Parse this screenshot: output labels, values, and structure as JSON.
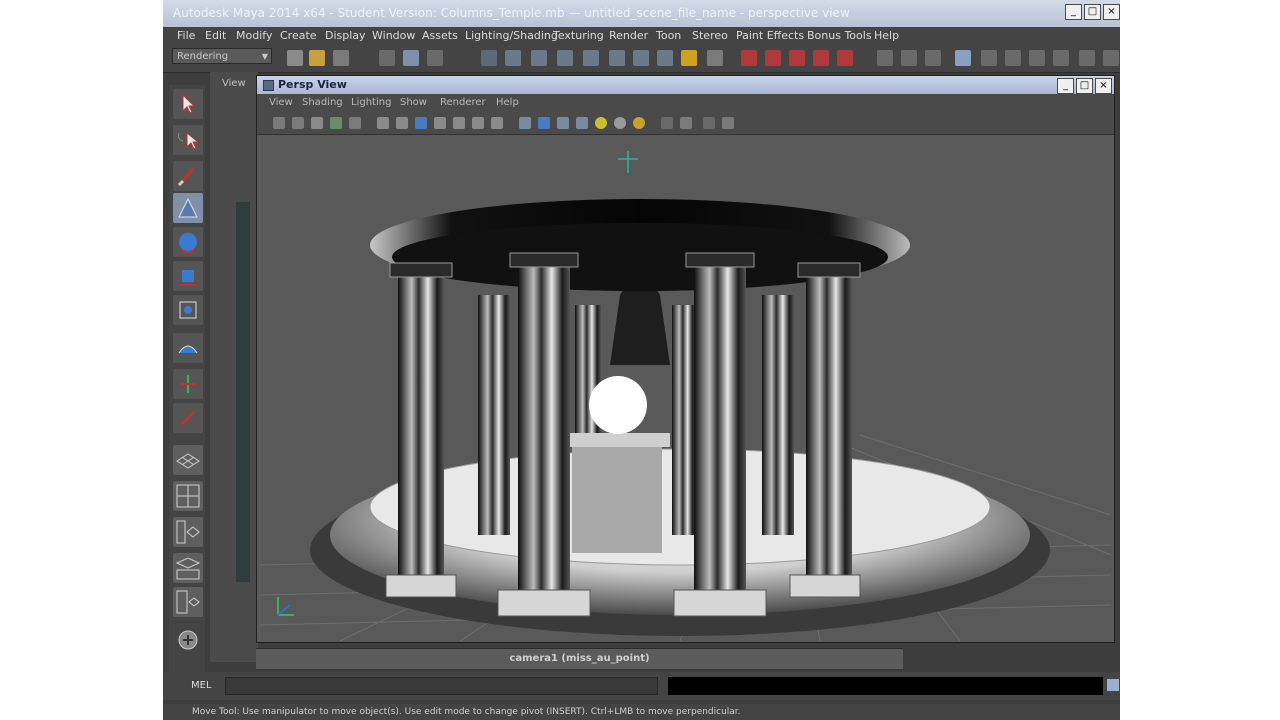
{
  "window": {
    "title": "Autodesk Maya 2014 x64 - Student Version: Columns_Temple.mb — untitled_scene_file_name - perspective view",
    "buttons": [
      "_",
      "□",
      "×"
    ]
  },
  "menubar": {
    "items": [
      "File",
      "Edit",
      "Modify",
      "Create",
      "Display",
      "Window",
      "Assets",
      "Lighting/Shading",
      "Texturing",
      "Render",
      "Toon",
      "Stereo",
      "Paint Effects",
      "Bonus Tools",
      "Help"
    ]
  },
  "toolbar": {
    "mode": "Rendering"
  },
  "back_panel": {
    "label": "View"
  },
  "persp_window": {
    "title": "Persp View",
    "buttons": [
      "_",
      "□",
      "×"
    ],
    "menu": [
      "View",
      "Shading",
      "Lighting",
      "Show",
      "Renderer",
      "Help"
    ]
  },
  "viewport": {
    "camera_label": "camera1 (miss_au_point)",
    "scene": "circular temple with columns, white sphere on pedestal"
  },
  "command_line": {
    "label": "MEL",
    "input_value": "",
    "output_value": ""
  },
  "help_line": {
    "text": "Move Tool: Use manipulator to move object(s). Use edit mode to change pivot (INSERT). Ctrl+LMB to move perpendicular."
  },
  "colors": {
    "app_bg": "#3d3d3d",
    "panel_bg": "#444444",
    "title_bar": "#b6c2d6",
    "viewport_bg": "#595959"
  }
}
